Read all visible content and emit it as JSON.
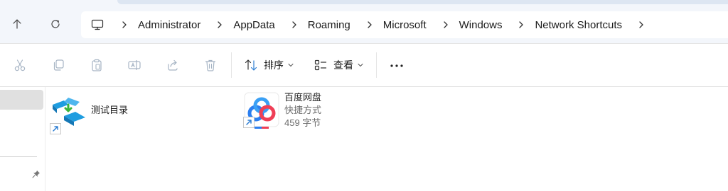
{
  "nav": {
    "up_icon": "arrow-up-icon",
    "refresh_icon": "refresh-icon"
  },
  "address": {
    "root_icon": "this-pc-icon",
    "crumbs": [
      "Administrator",
      "AppData",
      "Roaming",
      "Microsoft",
      "Windows",
      "Network Shortcuts"
    ]
  },
  "command_bar": {
    "cut_icon": "cut-icon",
    "copy_icon": "copy-icon",
    "paste_icon": "paste-icon",
    "rename_icon": "rename-icon",
    "share_icon": "share-icon",
    "delete_icon": "delete-icon",
    "sort_label": "排序",
    "view_label": "查看",
    "more_icon": "more-icon"
  },
  "items": [
    {
      "name": "测试目录",
      "type": "",
      "size": "",
      "icon": "network-folder-icon"
    },
    {
      "name": "百度网盘",
      "type": "快捷方式",
      "size": "459 字节",
      "icon": "baidu-netdisk-icon"
    }
  ],
  "colors": {
    "accent": "#2f7fd3",
    "baidu_blue": "#2b7ff0",
    "baidu_red": "#ef3f56",
    "network_teal": "#1f9de0",
    "network_green": "#3cb43c"
  }
}
